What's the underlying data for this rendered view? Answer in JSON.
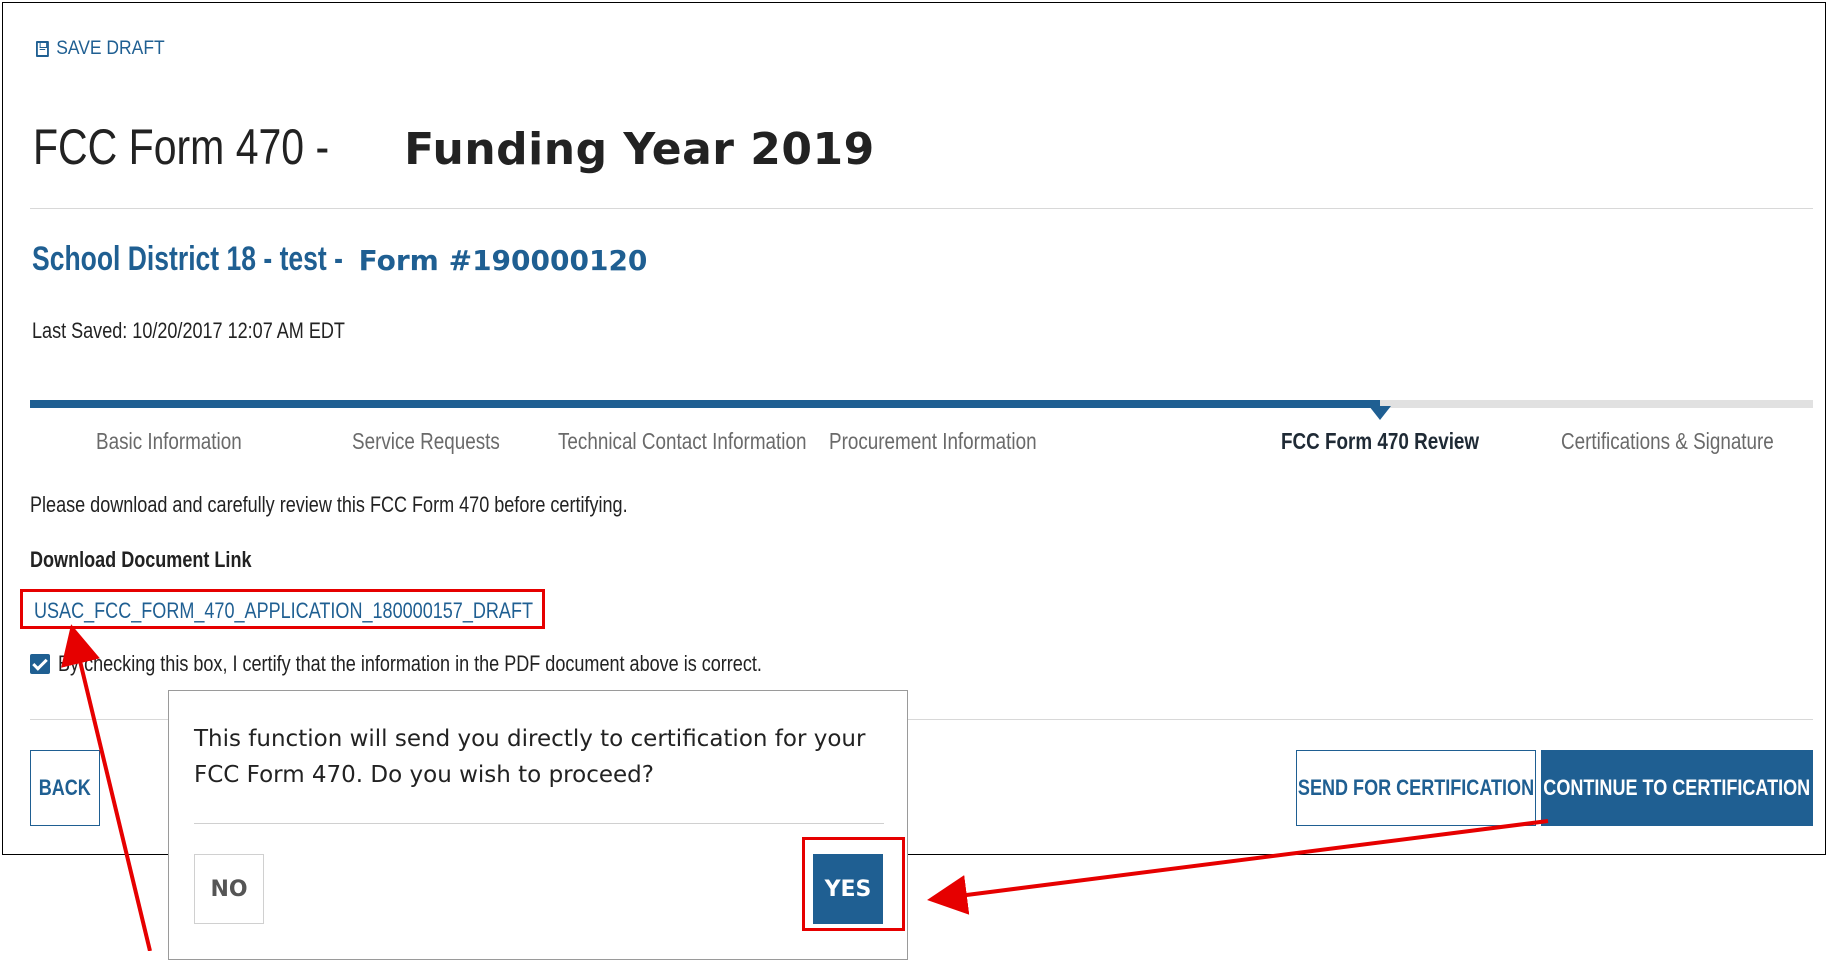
{
  "toolbar": {
    "save_draft_label": "SAVE DRAFT",
    "save_icon": "floppy-disk-icon"
  },
  "header": {
    "title_prefix": "FCC Form 470 -",
    "title_suffix": "Funding Year 2019",
    "subtitle_prefix": "School District 18 - test -",
    "subtitle_suffix": "Form #190000120",
    "last_saved": "Last Saved: 10/20/2017 12:07 AM EDT"
  },
  "progress": {
    "current_step_index": 4,
    "total_steps": 6
  },
  "steps": [
    {
      "label": "Basic Information",
      "active": false
    },
    {
      "label": "Service Requests",
      "active": false
    },
    {
      "label": "Technical Contact Information",
      "active": false
    },
    {
      "label": "Procurement Information",
      "active": false
    },
    {
      "label": "FCC Form 470 Review",
      "active": true
    },
    {
      "label": "Certifications & Signature",
      "active": false
    }
  ],
  "main": {
    "instruction": "Please download and carefully review this FCC Form 470 before certifying.",
    "download_label": "Download Document Link",
    "download_link": "USAC_FCC_FORM_470_APPLICATION_180000157_DRAFT",
    "certify_text": "By checking this box, I certify that the information in the PDF document above is correct.",
    "certify_checked": true
  },
  "buttons": {
    "back": "BACK",
    "send_for_certification": "SEND FOR CERTIFICATION",
    "continue_to_certification": "CONTINUE TO CERTIFICATION"
  },
  "dialog": {
    "message": "This function will send you directly to certification for your FCC Form 470. Do you wish to proceed?",
    "no": "NO",
    "yes": "YES"
  },
  "colors": {
    "primary": "#1f5f92",
    "annotation": "#e60000",
    "muted_text": "#6a6a6a"
  }
}
